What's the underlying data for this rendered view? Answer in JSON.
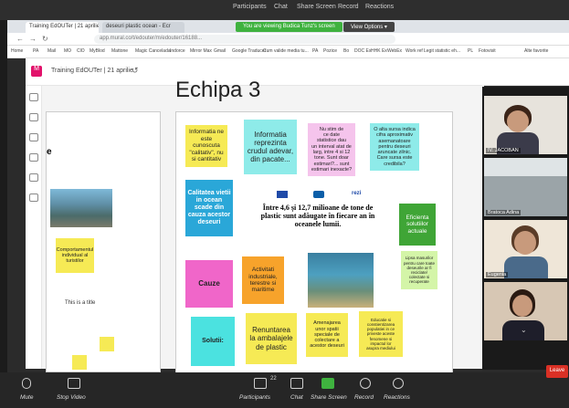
{
  "zoom_top": {
    "participants": "Participants",
    "chat": "Chat",
    "share_screen": "Share Screen",
    "record": "Record",
    "reactions": "Reactions"
  },
  "browser": {
    "tab1": "Training EdOUTer | 21 aprilie",
    "tab2": "deseuri plastic ocean - Ecr",
    "share_banner": "You are viewing Budica Tunz's screen",
    "view_options": "View Options ▾",
    "url": "app.mural.co/t/edouter/m/edouter/16188...",
    "bookmarks": [
      "Home",
      "PA",
      "Mail",
      "MO",
      "ClO",
      "MyBlod",
      "Mattone",
      "Magic Cancelada",
      "Indorce",
      "Mirror Max",
      "Gmail",
      "Google Traducer",
      "Cum valide media tu...",
      "PA",
      "Pozice",
      "Bo",
      "DOC Ex",
      "HHK Ex",
      "WebEx",
      "Work ref",
      "Legit statistic eh...",
      "PL",
      "Fotovisit",
      "Alte favorite"
    ]
  },
  "mural": {
    "board_title": "Training EdOUTer | 21 aprilie",
    "heading": "Echipa 3",
    "left_partial_label": "e",
    "left_sticky": "Comportamentul\nindividual al\nturistilor",
    "left_text": "This is a title"
  },
  "stickies": {
    "s1": "Informatia ne\neste\ncunoscuta\n\"calitativ\", nu\nsi cantitativ",
    "s2": "Informatia\nreprezinta\ncrudul adevar,\ndin pacate...",
    "s3": "Nu stim de\nce date\nstatistice dau\nun interval atat de\nlarg, intre 4 si 12\ntone. Sunt doar\nestimari?... sunt\nestimari inexacte?",
    "s4": "O alta sursa indica\ncifra aproximativ\nasemanatoare\npentru deseuri\naruncate zilnic.\nCare sursa este\ncredibila?",
    "s5": "Calitatea vietii\nin ocean\nscade din\ncauza acestor\ndeseuri",
    "s6": "Eficienta\nsolutiilor\nactuale",
    "s7": "Lipsa masurilor\npentru care toate\ndeseurile ar fi\nreciclate/\ncolectate si\nrecuperate",
    "s8": "Cauze",
    "s9": "Activitati\nindustriale,\nterestre si\nmaritime",
    "s10": "Solutii:",
    "s11": "Renuntarea\nla ambalajele\nde plastic",
    "s12": "Amenajarea\nunor spatii\nspeciale de\ncolectare a\nacestor deseuri",
    "s13": "Educatie si\nconstientizarea\npopulatiei in ce\npriveste aceste\nfenomene si\nimpactul lor\nasupra mediului"
  },
  "infographic": {
    "text": "Între 4,6 și 12,7 milioane de tone de plastic sunt adăugate în fiecare an în oceanele lumii."
  },
  "participants": [
    {
      "name": "IV. JACOBAN"
    },
    {
      "name": "Bratoca Adina"
    },
    {
      "name": "Eugenia"
    },
    {
      "name": ""
    }
  ],
  "zoom_bottom": {
    "mute": "Mute",
    "stop_video": "Stop Video",
    "participants": "Participants",
    "participants_count": "22",
    "chat": "Chat",
    "share_screen": "Share Screen",
    "record": "Record",
    "reactions": "Reactions",
    "leave": "Leave"
  },
  "colors": {
    "share_green": "#3fb23f",
    "leave_red": "#d93025"
  }
}
